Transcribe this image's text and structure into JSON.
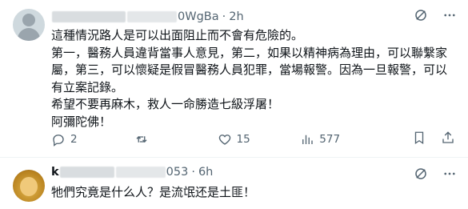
{
  "post1": {
    "name_visible": "",
    "handle_suffix": "0WgBa",
    "dot": "·",
    "time": "2h",
    "lines": [
      "這種情況路人是可以出面阻止而不會有危險的。",
      "第一，醫務人員違背當事人意見，第二，如果以精神病為理由，可以聯繫家屬，第三，可以懷疑是假冒醫務人員犯罪，當場報警。因為一旦報警，可以有立案記錄。",
      "希望不要再麻木，救人一命勝造七級浮屠！",
      "阿彌陀佛！"
    ],
    "actions": {
      "replies": "2",
      "retweets": "",
      "likes": "15",
      "views": "577"
    }
  },
  "post2": {
    "name_visible": "k",
    "handle_suffix": "053",
    "dot": "·",
    "time": "6h",
    "lines": [
      "牠們究竟是什么人？是流氓还是土匪！"
    ]
  },
  "icons": {
    "grok": "slash-circle-icon",
    "more": "more-dots-icon",
    "reply": "reply-bubble-icon",
    "retweet": "retweet-icon",
    "like": "heart-icon",
    "views": "views-bars-icon",
    "bookmark": "bookmark-icon",
    "share": "share-icon"
  },
  "colors": {
    "text": "#0f1419",
    "secondary": "#536471",
    "divider": "#eff3f4"
  }
}
